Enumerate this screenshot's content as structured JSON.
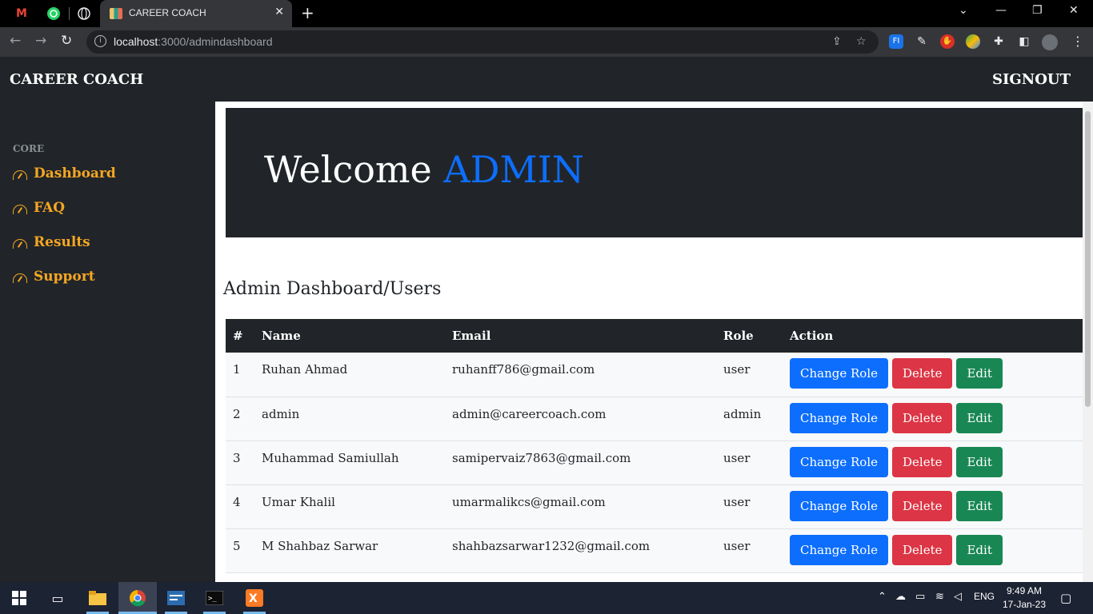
{
  "browser": {
    "tab_title": "CAREER COACH",
    "url_host": "localhost",
    "url_path": ":3000/admindashboard",
    "pinned": [
      "gmail-icon",
      "whatsapp-icon",
      "globe-icon"
    ]
  },
  "navbar": {
    "brand": "CAREER COACH",
    "signout": "SIGNOUT"
  },
  "sidebar": {
    "heading": "CORE",
    "items": [
      {
        "label": "Dashboard"
      },
      {
        "label": "FAQ"
      },
      {
        "label": "Results"
      },
      {
        "label": "Support"
      }
    ]
  },
  "welcome": {
    "prefix": "Welcome",
    "name": "ADMIN"
  },
  "section_title": "Admin Dashboard/Users",
  "table": {
    "headers": [
      "#",
      "Name",
      "Email",
      "Role",
      "Action"
    ],
    "rows": [
      {
        "num": "1",
        "name": "Ruhan Ahmad",
        "email": "ruhanff786@gmail.com",
        "role": "user"
      },
      {
        "num": "2",
        "name": "admin",
        "email": "admin@careercoach.com",
        "role": "admin"
      },
      {
        "num": "3",
        "name": "Muhammad Samiullah",
        "email": "samipervaiz7863@gmail.com",
        "role": "user"
      },
      {
        "num": "4",
        "name": "Umar Khalil",
        "email": "umarmalikcs@gmail.com",
        "role": "user"
      },
      {
        "num": "5",
        "name": "M Shahbaz Sarwar",
        "email": "shahbazsarwar1232@gmail.com",
        "role": "user"
      }
    ],
    "actions": {
      "change_role": "Change Role",
      "delete": "Delete",
      "edit": "Edit"
    }
  },
  "taskbar": {
    "language": "ENG",
    "time": "9:49 AM",
    "date": "17-Jan-23"
  },
  "colors": {
    "accent": "#0d6efd",
    "danger": "#dc3545",
    "success": "#198754",
    "sidebar_link": "#f5a623",
    "dark": "#212529"
  }
}
